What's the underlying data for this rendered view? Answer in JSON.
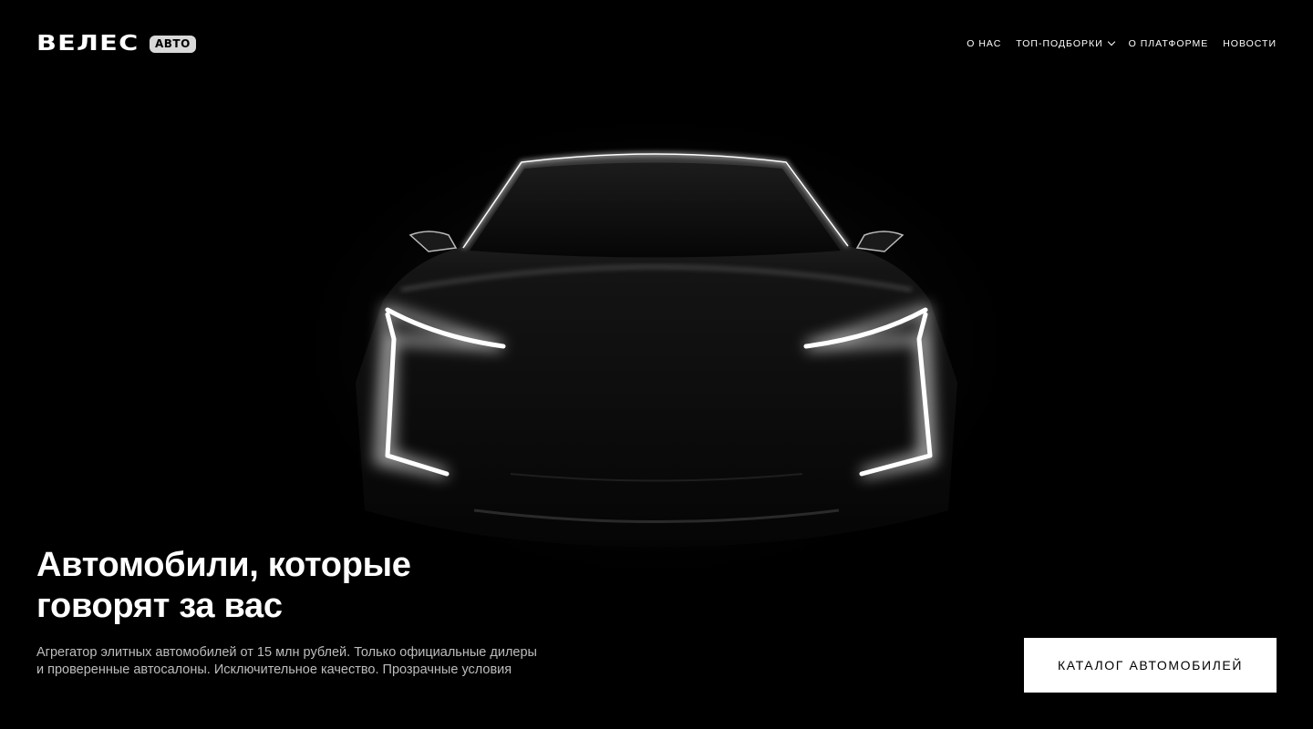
{
  "header": {
    "logo_word": "ВЕЛЕС",
    "logo_badge": "АВТО",
    "nav": [
      {
        "label": "О НАС"
      },
      {
        "label": "ТОП-ПОДБОРКИ"
      },
      {
        "label": "О ПЛАТФОРМЕ"
      },
      {
        "label": "НОВОСТИ"
      }
    ]
  },
  "hero": {
    "headline_line1": "Автомобили, которые",
    "headline_line2": "говорят за вас",
    "subtitle": "Агрегатор элитных автомобилей от 15 млн рублей. Только официальные дилеры и проверенные автосалоны. Исключительное качество. Прозрачные условия",
    "cta_label": "КАТАЛОГ АВТОМОБИЛЕЙ"
  },
  "colors": {
    "background": "#000000",
    "text": "#ffffff",
    "muted_text": "#bdbdbd",
    "badge": "#d9d9d9"
  }
}
